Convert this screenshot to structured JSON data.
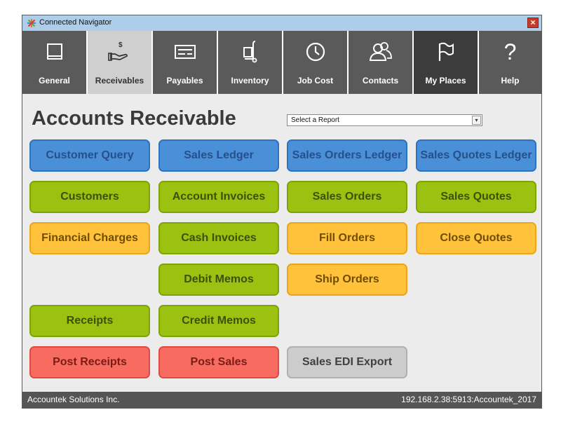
{
  "window": {
    "title": "Connected Navigator",
    "close_glyph": "×"
  },
  "nav": [
    {
      "label": "General",
      "icon": "book-icon"
    },
    {
      "label": "Receivables",
      "icon": "hand-dollar-icon"
    },
    {
      "label": "Payables",
      "icon": "check-icon"
    },
    {
      "label": "Inventory",
      "icon": "hand-truck-icon"
    },
    {
      "label": "Job Cost",
      "icon": "clock-icon"
    },
    {
      "label": "Contacts",
      "icon": "people-icon"
    },
    {
      "label": "My Places",
      "icon": "flag-icon"
    },
    {
      "label": "Help",
      "icon": "question-icon",
      "glyph": "?"
    }
  ],
  "active_nav": "Receivables",
  "page": {
    "heading": "Accounts Receivable",
    "report_select": {
      "value": "Select a Report",
      "arrow": "▾"
    }
  },
  "buttons": {
    "customer_query": "Customer Query",
    "sales_ledger": "Sales Ledger",
    "sales_orders_ledger": "Sales Orders Ledger",
    "sales_quotes_ledger": "Sales Quotes Ledger",
    "customers": "Customers",
    "account_invoices": "Account Invoices",
    "sales_orders": "Sales Orders",
    "sales_quotes": "Sales Quotes",
    "financial_charges": "Financial Charges",
    "cash_invoices": "Cash Invoices",
    "fill_orders": "Fill Orders",
    "close_quotes": "Close Quotes",
    "debit_memos": "Debit Memos",
    "ship_orders": "Ship Orders",
    "receipts": "Receipts",
    "credit_memos": "Credit Memos",
    "post_receipts": "Post Receipts",
    "post_sales": "Post Sales",
    "sales_edi_export": "Sales EDI Export"
  },
  "colors": {
    "blue": "#4a90d9",
    "green": "#9bc111",
    "orange": "#ffc23a",
    "red": "#f76b60",
    "gray": "#cccccc",
    "nav_tile": "#5a5a5a",
    "titlebar": "#aecde8"
  },
  "status": {
    "company": "Accountek Solutions Inc.",
    "connection": "192.168.2.38:5913:Accountek_2017"
  }
}
